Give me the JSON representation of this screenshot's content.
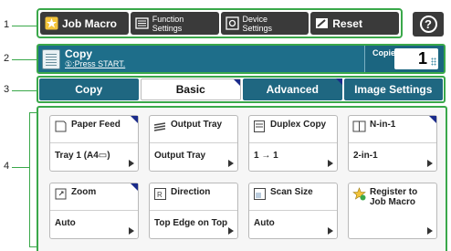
{
  "callouts": [
    "1",
    "2",
    "3",
    "4"
  ],
  "topbar": {
    "job_macro": "Job Macro",
    "function_settings": [
      "Function",
      "Settings"
    ],
    "device_settings": [
      "Device",
      "Settings"
    ],
    "reset": "Reset",
    "help": "?"
  },
  "status": {
    "title": "Copy",
    "message": "①:Press START.",
    "copies_label": "Copies:",
    "copies_value": "1"
  },
  "tabs": [
    "Copy",
    "Basic",
    "Advanced",
    "Image Settings"
  ],
  "cards": [
    {
      "title": "Paper Feed",
      "value": "Tray 1 (A4▭)",
      "icon": "paper-feed-icon"
    },
    {
      "title": "Output Tray",
      "value": "Output Tray",
      "icon": "output-tray-icon"
    },
    {
      "title": "Duplex Copy",
      "value": "1 → 1",
      "icon": "duplex-copy-icon"
    },
    {
      "title": "N-in-1",
      "value": "2-in-1",
      "icon": "n-in-1-icon"
    },
    {
      "title": "Zoom",
      "value": "Auto",
      "icon": "zoom-icon"
    },
    {
      "title": "Direction",
      "value": "Top Edge on Top",
      "icon": "direction-icon"
    },
    {
      "title": "Scan Size",
      "value": "Auto",
      "icon": "scan-size-icon"
    },
    {
      "title": "Register to Job Macro",
      "value": "",
      "icon": "register-job-macro-icon"
    }
  ]
}
